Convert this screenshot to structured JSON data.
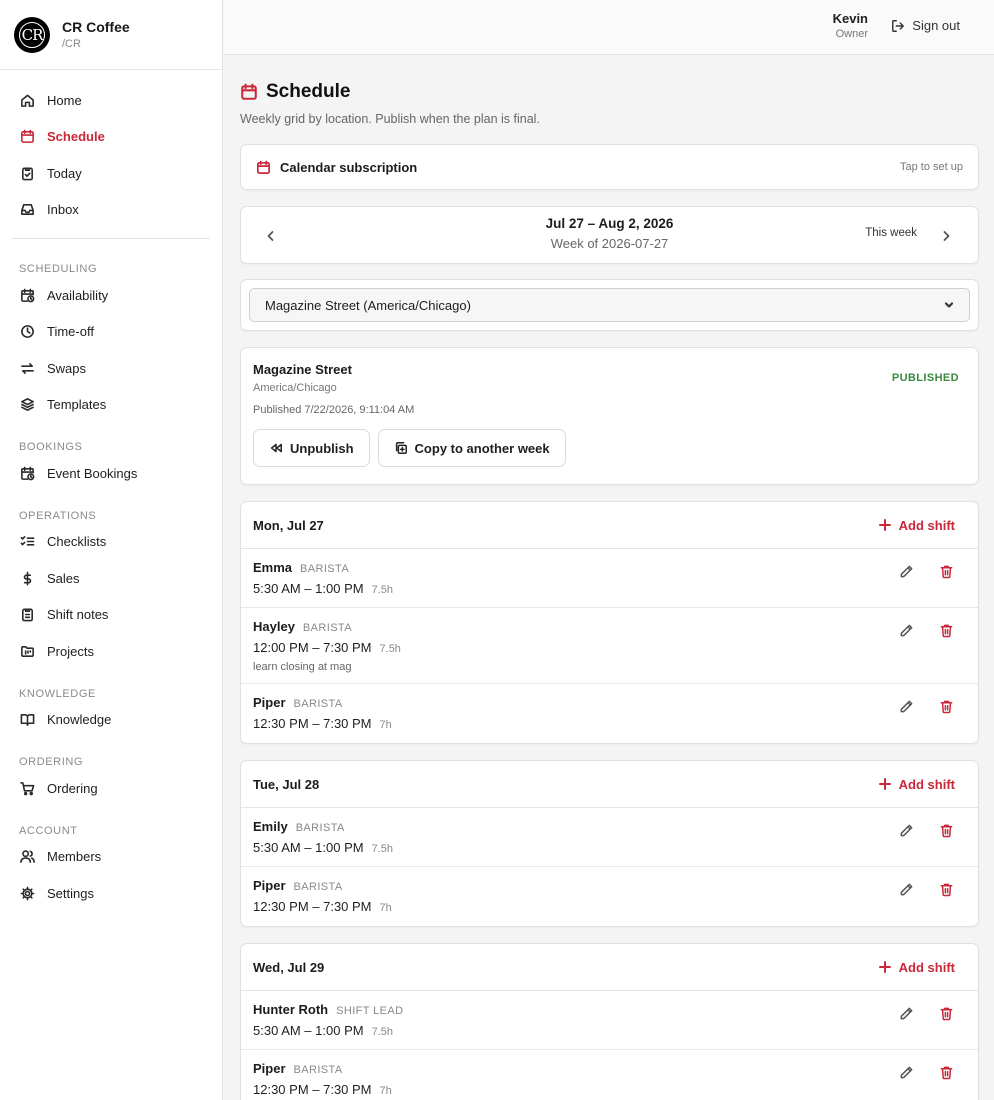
{
  "brand": {
    "name": "CR Coffee",
    "sub": "/CR",
    "logo_text": "CR"
  },
  "user": {
    "name": "Kevin",
    "role": "Owner",
    "signout": "Sign out"
  },
  "nav": {
    "home": "Home",
    "schedule": "Schedule",
    "today": "Today",
    "inbox": "Inbox",
    "sec_scheduling": "SCHEDULING",
    "availability": "Availability",
    "timeoff": "Time-off",
    "swaps": "Swaps",
    "templates": "Templates",
    "sec_bookings": "BOOKINGS",
    "event_bookings": "Event Bookings",
    "sec_operations": "OPERATIONS",
    "checklists": "Checklists",
    "sales": "Sales",
    "shift_notes": "Shift notes",
    "projects": "Projects",
    "sec_knowledge": "KNOWLEDGE",
    "knowledge": "Knowledge",
    "sec_ordering": "ORDERING",
    "ordering": "Ordering",
    "sec_account": "ACCOUNT",
    "members": "Members",
    "settings": "Settings"
  },
  "page": {
    "title": "Schedule",
    "subtitle": "Weekly grid by location. Publish when the plan is final."
  },
  "calendar_sub": {
    "label": "Calendar subscription",
    "action": "Tap to set up"
  },
  "week": {
    "range": "Jul 27 – Aug 2, 2026",
    "week_of": "Week of 2026-07-27",
    "this_week": "This week"
  },
  "location_select": {
    "value": "Magazine Street (America/Chicago)"
  },
  "status": {
    "location": "Magazine Street",
    "timezone": "America/Chicago",
    "published_at": "Published 7/22/2026, 9:11:04 AM",
    "badge": "PUBLISHED",
    "badge_color": "#3a8a3e",
    "unpublish": "Unpublish",
    "copy": "Copy to another week"
  },
  "add_shift_label": "Add shift",
  "accent_color": "#c8283a",
  "days": [
    {
      "title": "Mon, Jul 27",
      "shifts": [
        {
          "name": "Emma",
          "role": "BARISTA",
          "time": "5:30 AM – 1:00 PM",
          "hours": "7.5h",
          "note": ""
        },
        {
          "name": "Hayley",
          "role": "BARISTA",
          "time": "12:00 PM – 7:30 PM",
          "hours": "7.5h",
          "note": "learn closing at mag"
        },
        {
          "name": "Piper",
          "role": "BARISTA",
          "time": "12:30 PM – 7:30 PM",
          "hours": "7h",
          "note": ""
        }
      ]
    },
    {
      "title": "Tue, Jul 28",
      "shifts": [
        {
          "name": "Emily",
          "role": "BARISTA",
          "time": "5:30 AM – 1:00 PM",
          "hours": "7.5h",
          "note": ""
        },
        {
          "name": "Piper",
          "role": "BARISTA",
          "time": "12:30 PM – 7:30 PM",
          "hours": "7h",
          "note": ""
        }
      ]
    },
    {
      "title": "Wed, Jul 29",
      "shifts": [
        {
          "name": "Hunter Roth",
          "role": "SHIFT LEAD",
          "time": "5:30 AM – 1:00 PM",
          "hours": "7.5h",
          "note": ""
        },
        {
          "name": "Piper",
          "role": "BARISTA",
          "time": "12:30 PM – 7:30 PM",
          "hours": "7h",
          "note": ""
        }
      ]
    }
  ]
}
